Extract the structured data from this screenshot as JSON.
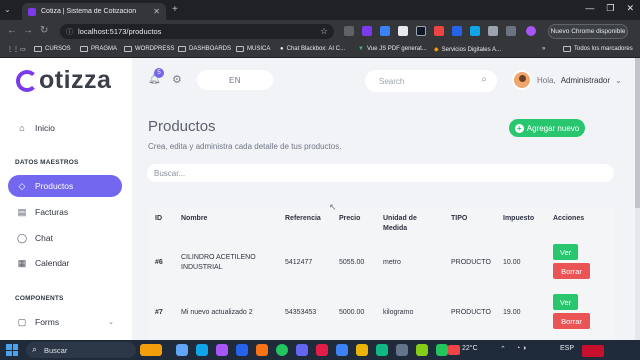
{
  "browser": {
    "tab_title": "Cotiza | Sistema de Cotizacion",
    "url": "localhost:5173/productos",
    "update_button": "Nuevo Chrome disponible",
    "bookmarks": [
      "CURSOS",
      "PRAGMA",
      "WORDPRESS",
      "DASHBOARDS",
      "MUSICA",
      "Chat Blackbox: AI C...",
      "Vue JS PDF generat...",
      "Servicios Digitales A...",
      "Todos los marcadores"
    ]
  },
  "brand": {
    "logo": "otizza",
    "accent": "#7367f0"
  },
  "sidebar": {
    "items": [
      {
        "label": "Inicio",
        "icon": "home-icon"
      },
      {
        "label": "Productos",
        "icon": "tag-icon"
      },
      {
        "label": "Facturas",
        "icon": "document-icon"
      },
      {
        "label": "Chat",
        "icon": "chat-icon"
      },
      {
        "label": "Calendar",
        "icon": "calendar-icon"
      },
      {
        "label": "Forms",
        "icon": "clipboard-icon"
      }
    ],
    "sections": {
      "master": "DATOS MAESTROS",
      "components": "COMPONENTS"
    }
  },
  "topbar": {
    "notification_count": "5",
    "language": "EN",
    "search_placeholder": "Search",
    "greeting": "Hola,",
    "user_name": "Administrador"
  },
  "page": {
    "title": "Productos",
    "subtitle": "Crea, edita y administra cada detalle de tus productos.",
    "add_button": "Agregar nuevo",
    "filter_placeholder": "Buscar..."
  },
  "table": {
    "headers": {
      "id": "ID",
      "nombre": "Nombre",
      "referencia": "Referencia",
      "precio": "Precio",
      "unidad": "Unidad de Medida",
      "tipo": "TIPO",
      "impuesto": "Impuesto",
      "acciones": "Acciones"
    },
    "rows": [
      {
        "id": "#6",
        "nombre": "CILINDRO ACETILENO INDUSTRIAL",
        "referencia": "5412477",
        "precio": "5055.00",
        "unidad": "metro",
        "tipo": "PRODUCTO",
        "impuesto": "10.00"
      },
      {
        "id": "#7",
        "nombre": "Mi nuevo actualizado 2",
        "referencia": "54353453",
        "precio": "5000.00",
        "unidad": "kilogramo",
        "tipo": "PRODUCTO",
        "impuesto": "19.00"
      }
    ],
    "actions": {
      "view": "Ver",
      "delete": "Borrar"
    }
  },
  "taskbar": {
    "search": "Buscar",
    "weather": "22°C",
    "language": "ESP"
  }
}
